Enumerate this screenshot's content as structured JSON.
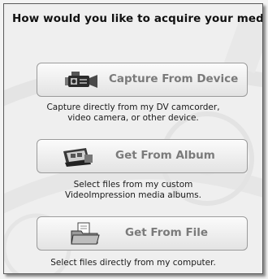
{
  "dialog": {
    "title": "How would you like to acquire your media?"
  },
  "options": [
    {
      "label": "Capture From Device",
      "description_lines": [
        "Capture directly from my DV camcorder,",
        "video camera, or other device."
      ],
      "icon": "camcorder-icon"
    },
    {
      "label": "Get From Album",
      "description_lines": [
        "Select files from my custom",
        "VideoImpression media albums."
      ],
      "icon": "photo-album-icon"
    },
    {
      "label": "Get From File",
      "description_lines": [
        "Select files directly from my computer."
      ],
      "icon": "folder-icon"
    }
  ],
  "colors": {
    "panel_background": "#efefef",
    "button_label": "#7a7a7a",
    "title_text": "#111111"
  }
}
